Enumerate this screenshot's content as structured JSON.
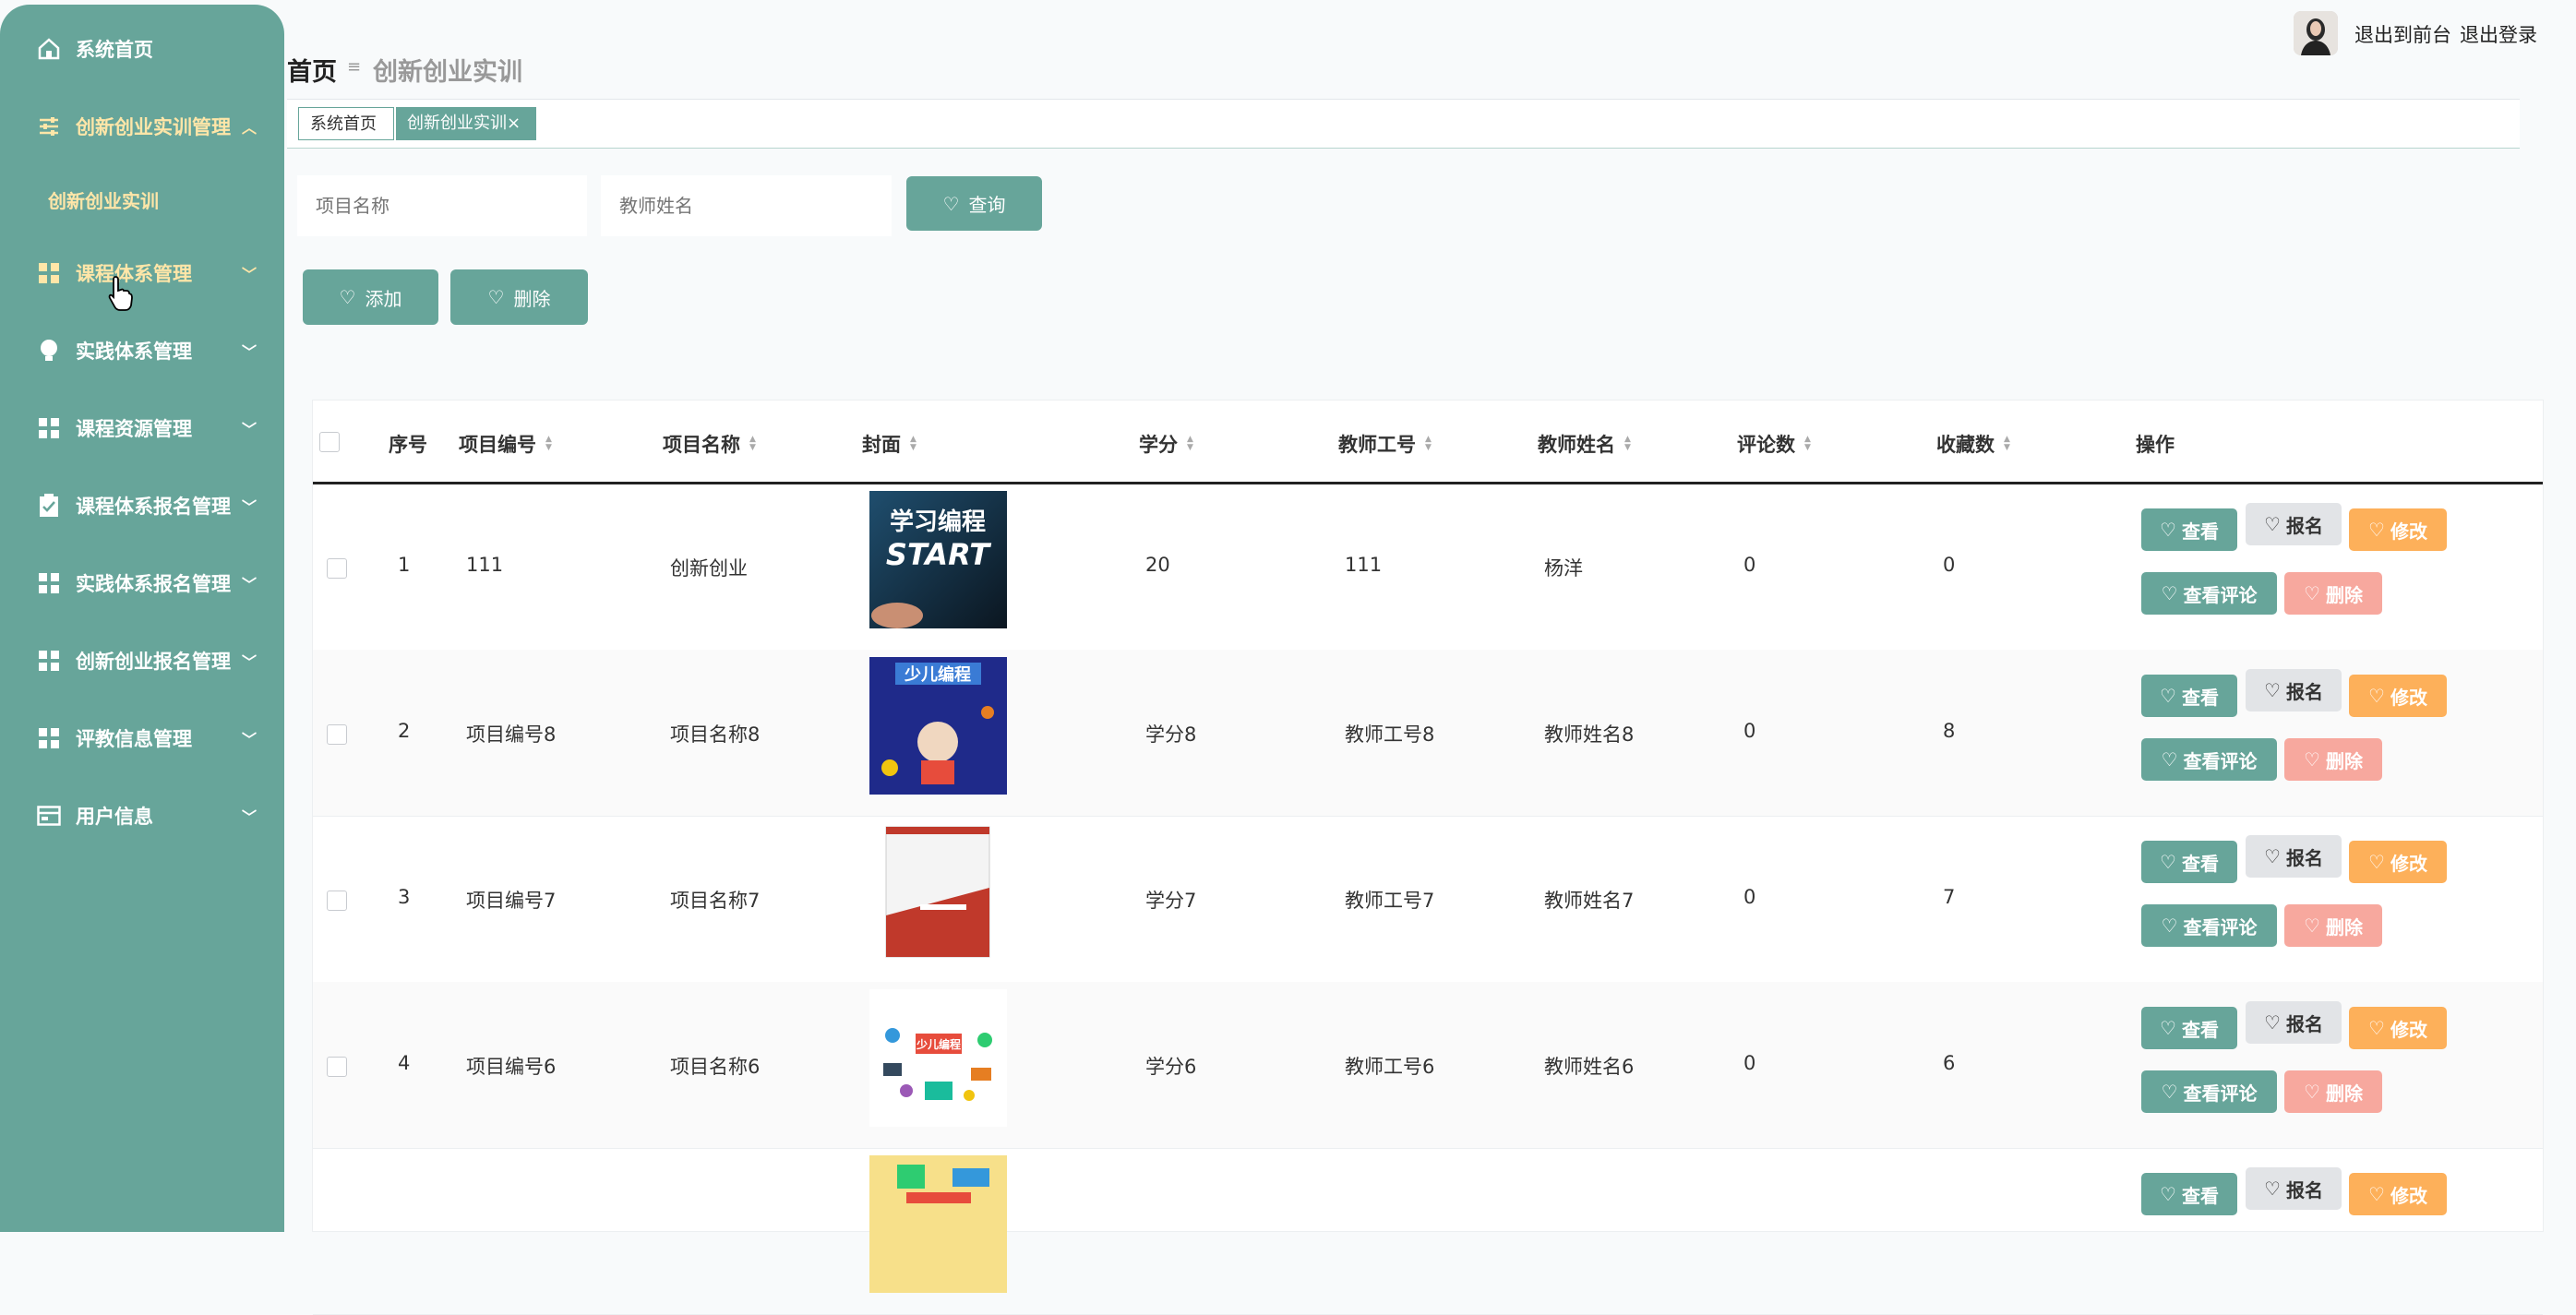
{
  "sidebar": {
    "items": [
      {
        "label": "系统首页",
        "icon": "home-icon"
      },
      {
        "label": "创新创业实训管理",
        "icon": "sliders-icon"
      },
      {
        "label": "课程体系管理",
        "icon": "grid-icon"
      },
      {
        "label": "实践体系管理",
        "icon": "bulb-icon"
      },
      {
        "label": "课程资源管理",
        "icon": "grid-icon"
      },
      {
        "label": "课程体系报名管理",
        "icon": "clipboard-icon"
      },
      {
        "label": "实践体系报名管理",
        "icon": "grid-icon"
      },
      {
        "label": "创新创业报名管理",
        "icon": "grid-icon"
      },
      {
        "label": "评教信息管理",
        "icon": "grid-icon"
      },
      {
        "label": "用户信息",
        "icon": "card-icon"
      }
    ],
    "submenu": "创新创业实训"
  },
  "header": {
    "home": "首页",
    "separator": "≡",
    "current": "创新创业实训",
    "links": [
      "退出到前台",
      "退出登录"
    ]
  },
  "tabs": {
    "home": "系统首页",
    "current": "创新创业实训×"
  },
  "search": {
    "project_placeholder": "项目名称",
    "teacher_placeholder": "教师姓名",
    "query_label": "查询"
  },
  "actions": {
    "add_label": "添加",
    "delete_label": "删除"
  },
  "table": {
    "columns": [
      "序号",
      "项目编号",
      "项目名称",
      "封面",
      "学分",
      "教师工号",
      "教师姓名",
      "评论数",
      "收藏数",
      "操作"
    ],
    "rows": [
      {
        "no": "1",
        "code": "111",
        "name": "创新创业",
        "credit": "20",
        "teacher_id": "111",
        "teacher": "杨洋",
        "comments": "0",
        "favorites": "0",
        "cover_text": "学习编程",
        "cover_text2": "START"
      },
      {
        "no": "2",
        "code": "项目编号8",
        "name": "项目名称8",
        "credit": "学分8",
        "teacher_id": "教师工号8",
        "teacher": "教师姓名8",
        "comments": "0",
        "favorites": "8",
        "cover_text": "少儿编程"
      },
      {
        "no": "3",
        "code": "项目编号7",
        "name": "项目名称7",
        "credit": "学分7",
        "teacher_id": "教师工号7",
        "teacher": "教师姓名7",
        "comments": "0",
        "favorites": "7"
      },
      {
        "no": "4",
        "code": "项目编号6",
        "name": "项目名称6",
        "credit": "学分6",
        "teacher_id": "教师工号6",
        "teacher": "教师姓名6",
        "comments": "0",
        "favorites": "6",
        "cover_text": "少儿编程"
      },
      {
        "no": "",
        "code": "",
        "name": "",
        "credit": "",
        "teacher_id": "",
        "teacher": "",
        "comments": "",
        "favorites": ""
      }
    ],
    "buttons": {
      "view": "查看",
      "sign": "报名",
      "edit": "修改",
      "comments": "查看评论",
      "delete": "删除"
    }
  },
  "colors": {
    "primary": "#67a59a",
    "accent_text": "#ffe6a8",
    "edit": "#fdb05a",
    "delete": "#f7a89e"
  }
}
